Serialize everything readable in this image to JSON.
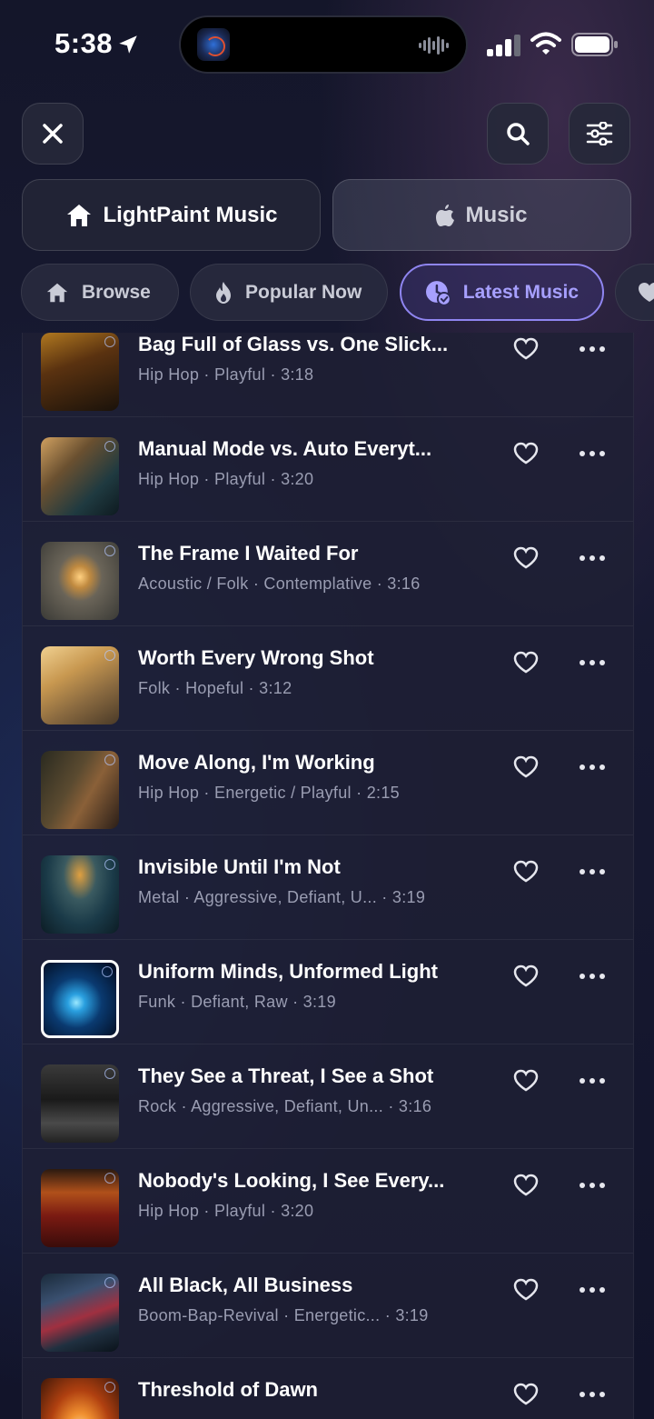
{
  "status": {
    "time": "5:38"
  },
  "header": {
    "close_icon": "close-icon",
    "search_icon": "search-icon",
    "filter_icon": "sliders-icon"
  },
  "source_tabs": [
    {
      "label": "LightPaint Music",
      "icon": "home-icon",
      "active": true
    },
    {
      "label": "Music",
      "icon": "apple-icon",
      "active": false
    }
  ],
  "pills": [
    {
      "label": "Browse",
      "icon": "home-icon"
    },
    {
      "label": "Popular Now",
      "icon": "flame-icon"
    },
    {
      "label": "Latest Music",
      "icon": "clock-check-icon",
      "active": true
    },
    {
      "label": "",
      "icon": "heart-icon"
    }
  ],
  "accent_color": "#8f85f0",
  "tracks": [
    {
      "title": "Bag Full of Glass vs. One Slick...",
      "meta": "Hip Hop · Playful",
      "duration": "3:18"
    },
    {
      "title": "Manual Mode vs. Auto Everyt...",
      "meta": "Hip Hop · Playful",
      "duration": "3:20"
    },
    {
      "title": "The Frame I Waited For",
      "meta": "Acoustic / Folk · Contemplative",
      "duration": "3:16"
    },
    {
      "title": "Worth Every Wrong Shot",
      "meta": "Folk · Hopeful",
      "duration": "3:12"
    },
    {
      "title": "Move Along, I'm Working",
      "meta": "Hip Hop · Energetic / Playful",
      "duration": "2:15"
    },
    {
      "title": "Invisible Until I'm Not",
      "meta": "Metal · Aggressive, Defiant, U...",
      "duration": "3:19"
    },
    {
      "title": "Uniform Minds, Unformed Light",
      "meta": "Funk · Defiant, Raw",
      "duration": "3:19"
    },
    {
      "title": "They See a Threat, I See a Shot",
      "meta": "Rock · Aggressive, Defiant, Un...",
      "duration": "3:16"
    },
    {
      "title": "Nobody's Looking, I See Every...",
      "meta": "Hip Hop · Playful",
      "duration": "3:20"
    },
    {
      "title": "All Black, All Business",
      "meta": "Boom-Bap-Revival · Energetic...",
      "duration": "3:19"
    },
    {
      "title": "Threshold of Dawn",
      "meta": "",
      "duration": ""
    }
  ]
}
